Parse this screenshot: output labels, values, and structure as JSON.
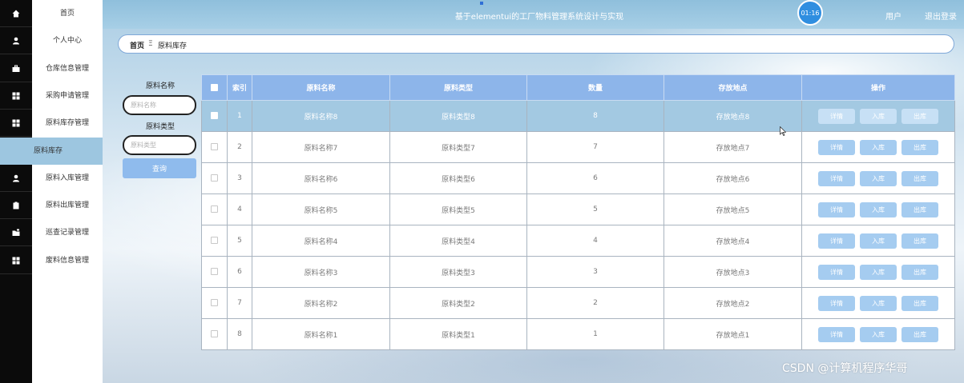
{
  "header": {
    "title": "基于elementui的工厂物料管理系统设计与实现",
    "user_label": "用户",
    "logout_label": "退出登录",
    "clock": "01:16"
  },
  "sidebar": {
    "items": [
      {
        "label": "首页",
        "icon": "home-icon"
      },
      {
        "label": "个人中心",
        "icon": "user-icon"
      },
      {
        "label": "仓库信息管理",
        "icon": "briefcase-icon"
      },
      {
        "label": "采购申请管理",
        "icon": "grid-icon"
      },
      {
        "label": "原料库存管理",
        "icon": "grid-icon"
      },
      {
        "label": "原料库存",
        "icon": "",
        "active": true
      },
      {
        "label": "原料入库管理",
        "icon": "user-icon"
      },
      {
        "label": "原料出库管理",
        "icon": "clipboard-icon"
      },
      {
        "label": "巡查记录管理",
        "icon": "folder-icon"
      },
      {
        "label": "废料信息管理",
        "icon": "grid-icon"
      }
    ]
  },
  "breadcrumb": {
    "home": "首页",
    "separator": "Ξ",
    "current": "原料库存"
  },
  "search": {
    "name_label": "原料名称",
    "name_placeholder": "原料名称",
    "type_label": "原料类型",
    "type_placeholder": "原料类型",
    "button": "查询"
  },
  "table": {
    "columns": [
      "索引",
      "原料名称",
      "原料类型",
      "数量",
      "存放地点",
      "操作"
    ],
    "actions": {
      "detail": "详情",
      "in": "入库",
      "out": "出库"
    },
    "rows": [
      {
        "index": "1",
        "name": "原料名称8",
        "type": "原料类型8",
        "qty": "8",
        "location": "存放地点8"
      },
      {
        "index": "2",
        "name": "原料名称7",
        "type": "原料类型7",
        "qty": "7",
        "location": "存放地点7"
      },
      {
        "index": "3",
        "name": "原料名称6",
        "type": "原料类型6",
        "qty": "6",
        "location": "存放地点6"
      },
      {
        "index": "4",
        "name": "原料名称5",
        "type": "原料类型5",
        "qty": "5",
        "location": "存放地点5"
      },
      {
        "index": "5",
        "name": "原料名称4",
        "type": "原料类型4",
        "qty": "4",
        "location": "存放地点4"
      },
      {
        "index": "6",
        "name": "原料名称3",
        "type": "原料类型3",
        "qty": "3",
        "location": "存放地点3"
      },
      {
        "index": "7",
        "name": "原料名称2",
        "type": "原料类型2",
        "qty": "2",
        "location": "存放地点2"
      },
      {
        "index": "8",
        "name": "原料名称1",
        "type": "原料类型1",
        "qty": "1",
        "location": "存放地点1"
      }
    ]
  },
  "watermark": "CSDN @计算机程序华哥",
  "colors": {
    "header": "#a7cfe6",
    "table_header": "#8db5ea",
    "active_row": "#a3c9e2",
    "button": "#a5ccf0"
  }
}
